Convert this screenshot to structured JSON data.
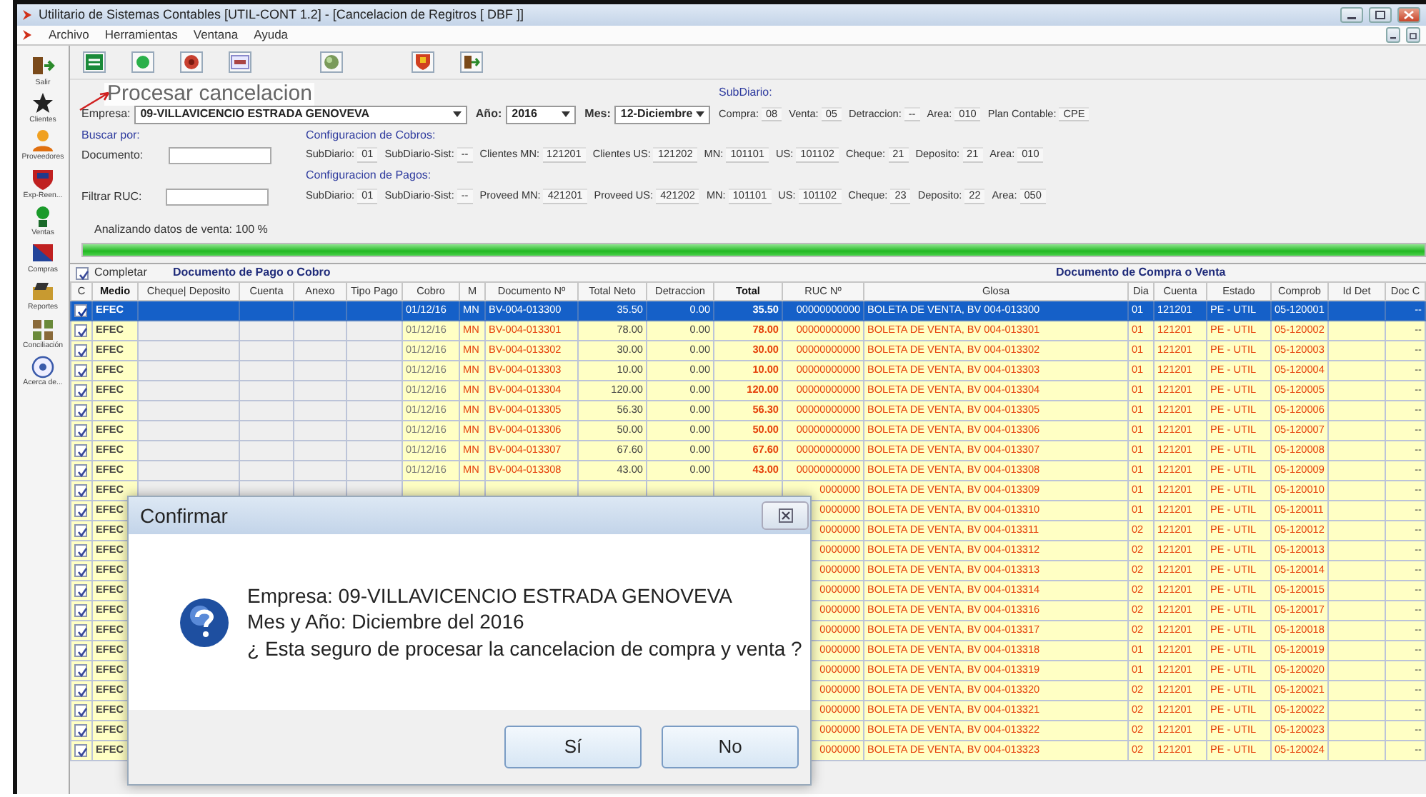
{
  "window": {
    "title": "Utilitario de Sistemas Contables [UTIL-CONT 1.2] - [Cancelacion de Regitros [ DBF ]]",
    "menu": [
      "Archivo",
      "Herramientas",
      "Ventana",
      "Ayuda"
    ]
  },
  "sidebar": [
    {
      "label": "Salir",
      "kind": "exit"
    },
    {
      "label": "Clientes",
      "kind": "star"
    },
    {
      "label": "Proveedores",
      "kind": "person"
    },
    {
      "label": "Exp-Reen...",
      "kind": "shield"
    },
    {
      "label": "Ventas",
      "kind": "ball"
    },
    {
      "label": "Compras",
      "kind": "flag"
    },
    {
      "label": "Reportes",
      "kind": "folder"
    },
    {
      "label": "Conciliación",
      "kind": "grid"
    },
    {
      "label": "Acerca de...",
      "kind": "help"
    }
  ],
  "tooltip": "Procesar cancelacion",
  "filters": {
    "empresa_label": "Empresa:",
    "empresa": "09-VILLAVICENCIO ESTRADA GENOVEVA",
    "anio_label": "Año:",
    "anio": "2016",
    "mes_label": "Mes:",
    "mes": "12-Diciembre",
    "buscar_label": "Buscar por:",
    "documento_label": "Documento:",
    "filtrar_label": "Filtrar RUC:"
  },
  "subdiario": {
    "title": "SubDiario:",
    "fields": [
      {
        "label": "Compra:",
        "value": "08"
      },
      {
        "label": "Venta:",
        "value": "05"
      },
      {
        "label": "Detraccion:",
        "value": "--"
      },
      {
        "label": "Area:",
        "value": "010"
      },
      {
        "label": "Plan Contable:",
        "value": "CPE"
      }
    ]
  },
  "cobros": {
    "title": "Configuracion de Cobros:",
    "fields": [
      {
        "label": "SubDiario:",
        "value": "01"
      },
      {
        "label": "SubDiario-Sist:",
        "value": "--"
      },
      {
        "label": "Clientes MN:",
        "value": "121201"
      },
      {
        "label": "Clientes US:",
        "value": "121202"
      },
      {
        "label": "MN:",
        "value": "101101"
      },
      {
        "label": "US:",
        "value": "101102"
      },
      {
        "label": "Cheque:",
        "value": "21"
      },
      {
        "label": "Deposito:",
        "value": "21"
      },
      {
        "label": "Area:",
        "value": "010"
      }
    ]
  },
  "pagos": {
    "title": "Configuracion de Pagos:",
    "fields": [
      {
        "label": "SubDiario:",
        "value": "01"
      },
      {
        "label": "SubDiario-Sist:",
        "value": "--"
      },
      {
        "label": "Proveed MN:",
        "value": "421201"
      },
      {
        "label": "Proveed US:",
        "value": "421202"
      },
      {
        "label": "MN:",
        "value": "101101"
      },
      {
        "label": "US:",
        "value": "101102"
      },
      {
        "label": "Cheque:",
        "value": "23"
      },
      {
        "label": "Deposito:",
        "value": "22"
      },
      {
        "label": "Area:",
        "value": "050"
      }
    ]
  },
  "progress": {
    "label": "Analizando datos de venta: 100 %",
    "level": 1
  },
  "table": {
    "completar": {
      "label": "Completar",
      "checked": true
    },
    "group_1": "Documento de Pago o Cobro",
    "group_2": "Documento de Compra o Venta",
    "columns": [
      {
        "label": "C",
        "bold": false
      },
      {
        "label": "Medio",
        "bold": true
      },
      {
        "label": "Cheque| Deposito",
        "bold": false
      },
      {
        "label": "Cuenta",
        "bold": false
      },
      {
        "label": "Anexo",
        "bold": false
      },
      {
        "label": "Tipo Pago",
        "bold": false
      },
      {
        "label": "Cobro",
        "bold": false
      },
      {
        "label": "M",
        "bold": false
      },
      {
        "label": "Documento Nº",
        "bold": false
      },
      {
        "label": "Total Neto",
        "bold": false
      },
      {
        "label": "Detraccion",
        "bold": false
      },
      {
        "label": "Total",
        "bold": true
      },
      {
        "label": "RUC Nº",
        "bold": false
      },
      {
        "label": "Glosa",
        "bold": false
      },
      {
        "label": "Dia",
        "bold": false
      },
      {
        "label": "Cuenta",
        "bold": false
      },
      {
        "label": "Estado",
        "bold": false
      },
      {
        "label": "Comprob",
        "bold": false
      },
      {
        "label": "Id Det",
        "bold": false
      },
      {
        "label": "Doc C",
        "bold": false
      }
    ],
    "rows": [
      {
        "checked": true,
        "selected": true,
        "medio": "EFEC",
        "cobro": "01/12/16",
        "m": "MN",
        "documento": "BV-004-013300",
        "total_neto": "35.50",
        "detraccion": "0.00",
        "total": "35.50",
        "ruc": "00000000000",
        "glosa": "BOLETA DE VENTA, BV 004-013300",
        "dia": "01",
        "cuenta": "121201",
        "estado": "PE - UTIL",
        "comprob": "05-120001",
        "doc_c": "--"
      },
      {
        "checked": true,
        "selected": false,
        "medio": "EFEC",
        "cobro": "01/12/16",
        "m": "MN",
        "documento": "BV-004-013301",
        "total_neto": "78.00",
        "detraccion": "0.00",
        "total": "78.00",
        "ruc": "00000000000",
        "glosa": "BOLETA DE VENTA, BV 004-013301",
        "dia": "01",
        "cuenta": "121201",
        "estado": "PE - UTIL",
        "comprob": "05-120002",
        "doc_c": "--"
      },
      {
        "checked": true,
        "selected": false,
        "medio": "EFEC",
        "cobro": "01/12/16",
        "m": "MN",
        "documento": "BV-004-013302",
        "total_neto": "30.00",
        "detraccion": "0.00",
        "total": "30.00",
        "ruc": "00000000000",
        "glosa": "BOLETA DE VENTA, BV 004-013302",
        "dia": "01",
        "cuenta": "121201",
        "estado": "PE - UTIL",
        "comprob": "05-120003",
        "doc_c": "--"
      },
      {
        "checked": true,
        "selected": false,
        "medio": "EFEC",
        "cobro": "01/12/16",
        "m": "MN",
        "documento": "BV-004-013303",
        "total_neto": "10.00",
        "detraccion": "0.00",
        "total": "10.00",
        "ruc": "00000000000",
        "glosa": "BOLETA DE VENTA, BV 004-013303",
        "dia": "01",
        "cuenta": "121201",
        "estado": "PE - UTIL",
        "comprob": "05-120004",
        "doc_c": "--"
      },
      {
        "checked": true,
        "selected": false,
        "medio": "EFEC",
        "cobro": "01/12/16",
        "m": "MN",
        "documento": "BV-004-013304",
        "total_neto": "120.00",
        "detraccion": "0.00",
        "total": "120.00",
        "ruc": "00000000000",
        "glosa": "BOLETA DE VENTA, BV 004-013304",
        "dia": "01",
        "cuenta": "121201",
        "estado": "PE - UTIL",
        "comprob": "05-120005",
        "doc_c": "--"
      },
      {
        "checked": true,
        "selected": false,
        "medio": "EFEC",
        "cobro": "01/12/16",
        "m": "MN",
        "documento": "BV-004-013305",
        "total_neto": "56.30",
        "detraccion": "0.00",
        "total": "56.30",
        "ruc": "00000000000",
        "glosa": "BOLETA DE VENTA, BV 004-013305",
        "dia": "01",
        "cuenta": "121201",
        "estado": "PE - UTIL",
        "comprob": "05-120006",
        "doc_c": "--"
      },
      {
        "checked": true,
        "selected": false,
        "medio": "EFEC",
        "cobro": "01/12/16",
        "m": "MN",
        "documento": "BV-004-013306",
        "total_neto": "50.00",
        "detraccion": "0.00",
        "total": "50.00",
        "ruc": "00000000000",
        "glosa": "BOLETA DE VENTA, BV 004-013306",
        "dia": "01",
        "cuenta": "121201",
        "estado": "PE - UTIL",
        "comprob": "05-120007",
        "doc_c": "--"
      },
      {
        "checked": true,
        "selected": false,
        "medio": "EFEC",
        "cobro": "01/12/16",
        "m": "MN",
        "documento": "BV-004-013307",
        "total_neto": "67.60",
        "detraccion": "0.00",
        "total": "67.60",
        "ruc": "00000000000",
        "glosa": "BOLETA DE VENTA, BV 004-013307",
        "dia": "01",
        "cuenta": "121201",
        "estado": "PE - UTIL",
        "comprob": "05-120008",
        "doc_c": "--"
      },
      {
        "checked": true,
        "selected": false,
        "medio": "EFEC",
        "cobro": "01/12/16",
        "m": "MN",
        "documento": "BV-004-013308",
        "total_neto": "43.00",
        "detraccion": "0.00",
        "total": "43.00",
        "ruc": "00000000000",
        "glosa": "BOLETA DE VENTA, BV 004-013308",
        "dia": "01",
        "cuenta": "121201",
        "estado": "PE - UTIL",
        "comprob": "05-120009",
        "doc_c": "--"
      },
      {
        "checked": true,
        "selected": false,
        "medio": "EFEC",
        "ruc": "0000000",
        "glosa": "BOLETA DE VENTA, BV 004-013309",
        "dia": "01",
        "cuenta": "121201",
        "estado": "PE - UTIL",
        "comprob": "05-120010",
        "doc_c": "--"
      },
      {
        "checked": true,
        "selected": false,
        "medio": "EFEC",
        "ruc": "0000000",
        "glosa": "BOLETA DE VENTA, BV 004-013310",
        "dia": "01",
        "cuenta": "121201",
        "estado": "PE - UTIL",
        "comprob": "05-120011",
        "doc_c": "--"
      },
      {
        "checked": true,
        "selected": false,
        "medio": "EFEC",
        "ruc": "0000000",
        "glosa": "BOLETA DE VENTA, BV 004-013311",
        "dia": "02",
        "cuenta": "121201",
        "estado": "PE - UTIL",
        "comprob": "05-120012",
        "doc_c": "--"
      },
      {
        "checked": true,
        "selected": false,
        "medio": "EFEC",
        "ruc": "0000000",
        "glosa": "BOLETA DE VENTA, BV 004-013312",
        "dia": "02",
        "cuenta": "121201",
        "estado": "PE - UTIL",
        "comprob": "05-120013",
        "doc_c": "--"
      },
      {
        "checked": true,
        "selected": false,
        "medio": "EFEC",
        "ruc": "0000000",
        "glosa": "BOLETA DE VENTA, BV 004-013313",
        "dia": "02",
        "cuenta": "121201",
        "estado": "PE - UTIL",
        "comprob": "05-120014",
        "doc_c": "--"
      },
      {
        "checked": true,
        "selected": false,
        "medio": "EFEC",
        "ruc": "0000000",
        "glosa": "BOLETA DE VENTA, BV 004-013314",
        "dia": "02",
        "cuenta": "121201",
        "estado": "PE - UTIL",
        "comprob": "05-120015",
        "doc_c": "--"
      },
      {
        "checked": true,
        "selected": false,
        "medio": "EFEC",
        "ruc": "0000000",
        "glosa": "BOLETA DE VENTA, BV 004-013316",
        "dia": "02",
        "cuenta": "121201",
        "estado": "PE - UTIL",
        "comprob": "05-120017",
        "doc_c": "--"
      },
      {
        "checked": true,
        "selected": false,
        "medio": "EFEC",
        "ruc": "0000000",
        "glosa": "BOLETA DE VENTA, BV 004-013317",
        "dia": "02",
        "cuenta": "121201",
        "estado": "PE - UTIL",
        "comprob": "05-120018",
        "doc_c": "--"
      },
      {
        "checked": true,
        "selected": false,
        "medio": "EFEC",
        "ruc": "0000000",
        "glosa": "BOLETA DE VENTA, BV 004-013318",
        "dia": "01",
        "cuenta": "121201",
        "estado": "PE - UTIL",
        "comprob": "05-120019",
        "doc_c": "--"
      },
      {
        "checked": true,
        "selected": false,
        "medio": "EFEC",
        "ruc": "0000000",
        "glosa": "BOLETA DE VENTA, BV 004-013319",
        "dia": "01",
        "cuenta": "121201",
        "estado": "PE - UTIL",
        "comprob": "05-120020",
        "doc_c": "--"
      },
      {
        "checked": true,
        "selected": false,
        "medio": "EFEC",
        "ruc": "0000000",
        "glosa": "BOLETA DE VENTA, BV 004-013320",
        "dia": "02",
        "cuenta": "121201",
        "estado": "PE - UTIL",
        "comprob": "05-120021",
        "doc_c": "--"
      },
      {
        "checked": true,
        "selected": false,
        "medio": "EFEC",
        "ruc": "0000000",
        "glosa": "BOLETA DE VENTA, BV 004-013321",
        "dia": "02",
        "cuenta": "121201",
        "estado": "PE - UTIL",
        "comprob": "05-120022",
        "doc_c": "--"
      },
      {
        "checked": true,
        "selected": false,
        "medio": "EFEC",
        "ruc": "0000000",
        "glosa": "BOLETA DE VENTA, BV 004-013322",
        "dia": "02",
        "cuenta": "121201",
        "estado": "PE - UTIL",
        "comprob": "05-120023",
        "doc_c": "--"
      },
      {
        "checked": true,
        "selected": false,
        "medio": "EFEC",
        "ruc": "0000000",
        "glosa": "BOLETA DE VENTA, BV 004-013323",
        "dia": "02",
        "cuenta": "121201",
        "estado": "PE - UTIL",
        "comprob": "05-120024",
        "doc_c": "--"
      }
    ]
  },
  "dialog": {
    "title": "Confirmar",
    "lines": [
      "Empresa: 09-VILLAVICENCIO ESTRADA GENOVEVA",
      "Mes y Año: Diciembre del 2016",
      "¿ Esta seguro de procesar la cancelacion de compra y venta ?"
    ],
    "buttons": [
      "Sí",
      "No"
    ]
  }
}
